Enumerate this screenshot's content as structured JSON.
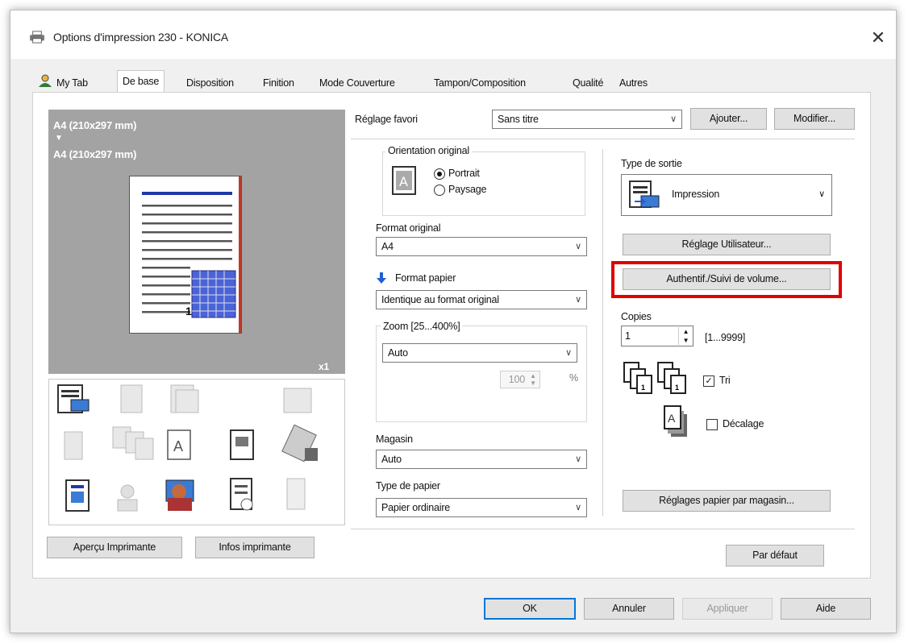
{
  "window": {
    "title": "Options d'impression 230 - KONICA",
    "close_glyph": "✕"
  },
  "tabs": [
    {
      "label": "My Tab"
    },
    {
      "label": "De base"
    },
    {
      "label": "Disposition"
    },
    {
      "label": "Finition"
    },
    {
      "label": "Mode Couverture"
    },
    {
      "label": "Tampon/Composition"
    },
    {
      "label": "Qualité"
    },
    {
      "label": "Autres"
    }
  ],
  "active_tab": "De base",
  "preview": {
    "original_size": "A4 (210x297 mm)",
    "output_size": "A4 (210x297 mm)",
    "arrow_glyph": "▼",
    "copies_badge": "x1",
    "page_number": "1"
  },
  "left_buttons": {
    "preview": "Aperçu Imprimante",
    "info": "Infos imprimante"
  },
  "favorite": {
    "label": "Réglage favori",
    "value": "Sans titre",
    "add": "Ajouter...",
    "modify": "Modifier..."
  },
  "orientation": {
    "group_title": "Orientation original",
    "portrait": "Portrait",
    "landscape": "Paysage",
    "selected": "Portrait",
    "icon_letter": "A"
  },
  "original_format": {
    "label": "Format original",
    "value": "A4"
  },
  "paper_format": {
    "label": "Format papier",
    "value": "Identique au format original"
  },
  "zoom": {
    "group_title": "Zoom [25...400%]",
    "value": "Auto",
    "percent": "100",
    "unit": "%"
  },
  "tray": {
    "label": "Magasin",
    "value": "Auto"
  },
  "paper_type": {
    "label": "Type de papier",
    "value": "Papier ordinaire"
  },
  "output": {
    "label": "Type de sortie",
    "value": "Impression"
  },
  "right_buttons": {
    "user_setting": "Réglage Utilisateur...",
    "auth": "Authentif./Suivi de volume...",
    "tray_paper": "Réglages papier par magasin...",
    "default": "Par défaut"
  },
  "copies": {
    "label": "Copies",
    "value": "1",
    "range": "[1...9999]"
  },
  "collate": {
    "label": "Tri",
    "checked": true,
    "check_glyph": "✓"
  },
  "offset": {
    "label": "Décalage",
    "checked": false
  },
  "chevron": "∨",
  "footer": {
    "ok": "OK",
    "cancel": "Annuler",
    "apply": "Appliquer",
    "help": "Aide"
  },
  "colors": {
    "highlight": "#e00000",
    "accent": "#0078d7",
    "preview_bg": "#a3a3a3"
  }
}
